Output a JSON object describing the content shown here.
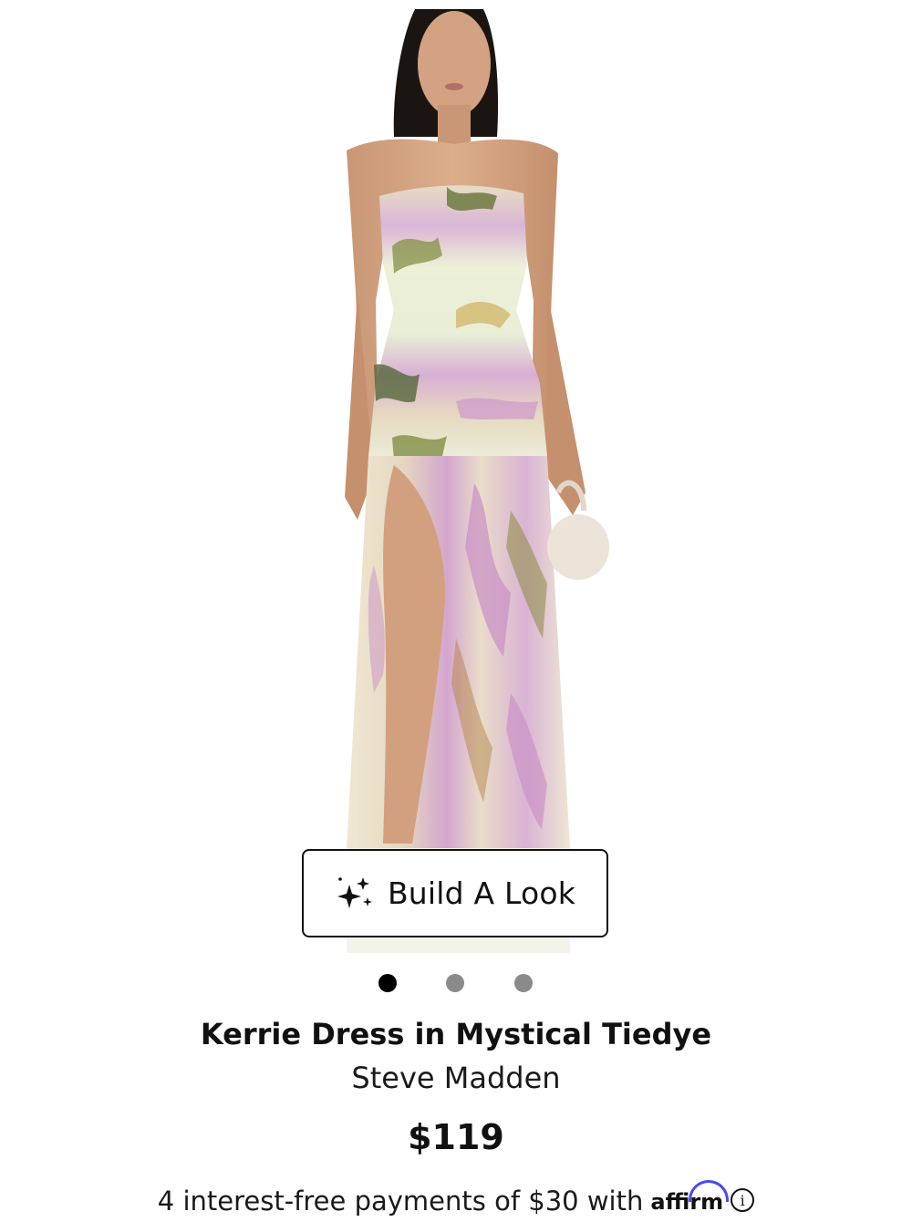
{
  "product": {
    "title": "Kerrie Dress in Mystical Tiedye",
    "brand": "Steve Madden",
    "price": "$119"
  },
  "gallery": {
    "image_icon": "model-wearing-dress-image",
    "dots_count": 3,
    "active_index": 0
  },
  "build_look": {
    "label": "Build A Look",
    "icon": "sparkles-icon"
  },
  "financing": {
    "text": "4 interest-free payments of $30 with",
    "provider": "affirm",
    "info_icon_glyph": "i"
  },
  "colors": {
    "affirm_arc": "#4a4af4",
    "active_dot": "#000000",
    "inactive_dot": "#8a8a8a"
  }
}
